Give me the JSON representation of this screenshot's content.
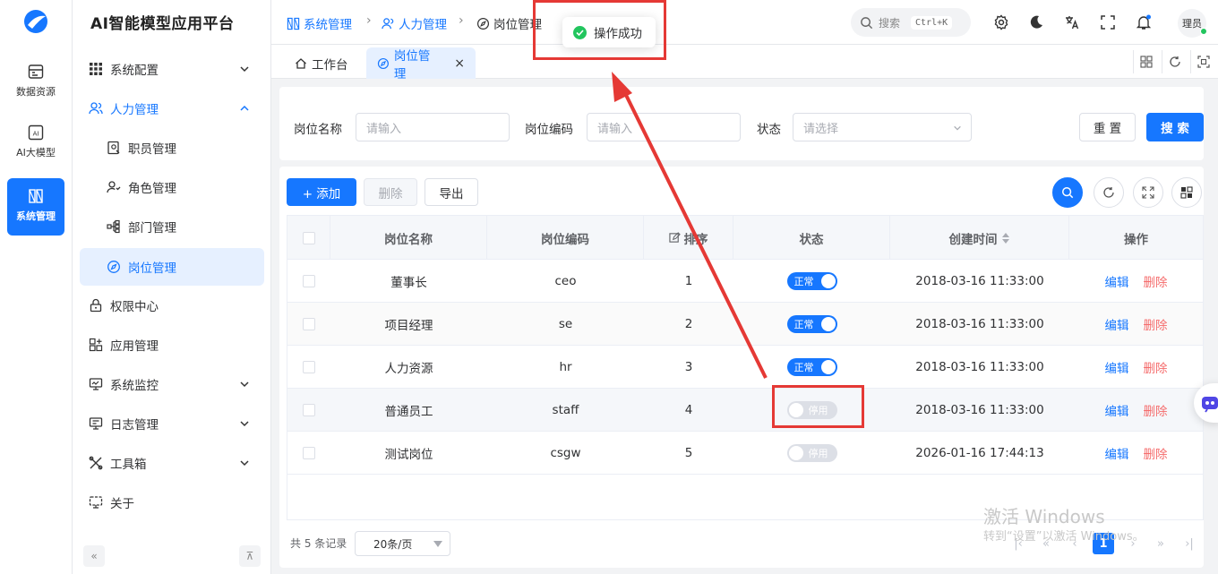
{
  "rail": {
    "items": [
      {
        "label": "数据资源",
        "icon": "database-icon"
      },
      {
        "label": "AI大模型",
        "icon": "ai-icon"
      },
      {
        "label": "系统管理",
        "icon": "system-icon",
        "active": true
      }
    ]
  },
  "sidebar": {
    "brand": "AI智能模型应用平台",
    "items": [
      {
        "label": "系统配置",
        "icon": "grid-icon",
        "expandable": true
      },
      {
        "label": "人力管理",
        "icon": "users-icon",
        "expandable": true,
        "open": true
      },
      {
        "label": "职员管理",
        "icon": "staff-icon",
        "sub": true
      },
      {
        "label": "角色管理",
        "icon": "role-icon",
        "sub": true
      },
      {
        "label": "部门管理",
        "icon": "dept-icon",
        "sub": true
      },
      {
        "label": "岗位管理",
        "icon": "compass-icon",
        "sub": true,
        "selected": true
      },
      {
        "label": "权限中心",
        "icon": "lock-icon"
      },
      {
        "label": "应用管理",
        "icon": "apps-icon"
      },
      {
        "label": "系统监控",
        "icon": "monitor-icon",
        "expandable": true
      },
      {
        "label": "日志管理",
        "icon": "log-icon",
        "expandable": true
      },
      {
        "label": "工具箱",
        "icon": "tools-icon",
        "expandable": true
      },
      {
        "label": "关于",
        "icon": "about-icon"
      }
    ],
    "collapse_glyph": "«",
    "pin_glyph": "⊼"
  },
  "header": {
    "breadcrumb": [
      "系统管理",
      "人力管理",
      "岗位管理"
    ],
    "search_placeholder": "搜索",
    "search_shortcut": "Ctrl+K",
    "avatar_text": "理员"
  },
  "tabs": [
    {
      "label": "工作台",
      "icon": "home-icon"
    },
    {
      "label": "岗位管理",
      "icon": "compass-icon",
      "active": true,
      "close": "×"
    }
  ],
  "filters": {
    "name_label": "岗位名称",
    "name_placeholder": "请输入",
    "code_label": "岗位编码",
    "code_placeholder": "请输入",
    "status_label": "状态",
    "status_placeholder": "请选择",
    "reset_label": "重 置",
    "search_label": "搜 索"
  },
  "toolbar": {
    "add_label": "+ 添加",
    "delete_label": "删除",
    "export_label": "导出"
  },
  "table": {
    "columns": [
      "岗位名称",
      "岗位编码",
      "排序",
      "状态",
      "创建时间",
      "操作"
    ],
    "rows": [
      {
        "name": "董事长",
        "code": "ceo",
        "sort": "1",
        "status": "正常",
        "on": true,
        "created": "2018-03-16 11:33:00"
      },
      {
        "name": "项目经理",
        "code": "se",
        "sort": "2",
        "status": "正常",
        "on": true,
        "created": "2018-03-16 11:33:00"
      },
      {
        "name": "人力资源",
        "code": "hr",
        "sort": "3",
        "status": "正常",
        "on": true,
        "created": "2018-03-16 11:33:00"
      },
      {
        "name": "普通员工",
        "code": "staff",
        "sort": "4",
        "status": "停用",
        "on": false,
        "created": "2018-03-16 11:33:00"
      },
      {
        "name": "测试岗位",
        "code": "csgw",
        "sort": "5",
        "status": "停用",
        "on": false,
        "created": "2026-01-16 17:44:13"
      }
    ],
    "edit_label": "编辑",
    "delete_label": "删除"
  },
  "pagination": {
    "total_text": "共 5 条记录",
    "page_size": "20条/页",
    "current_page": "1"
  },
  "toast": {
    "message": "操作成功"
  },
  "watermark": {
    "line1": "激活 Windows",
    "line2": "转到“设置”以激活 Windows。"
  },
  "colors": {
    "primary": "#1677ff",
    "danger": "#f56c6c",
    "success": "#22c55e",
    "annotation": "#e53935"
  }
}
